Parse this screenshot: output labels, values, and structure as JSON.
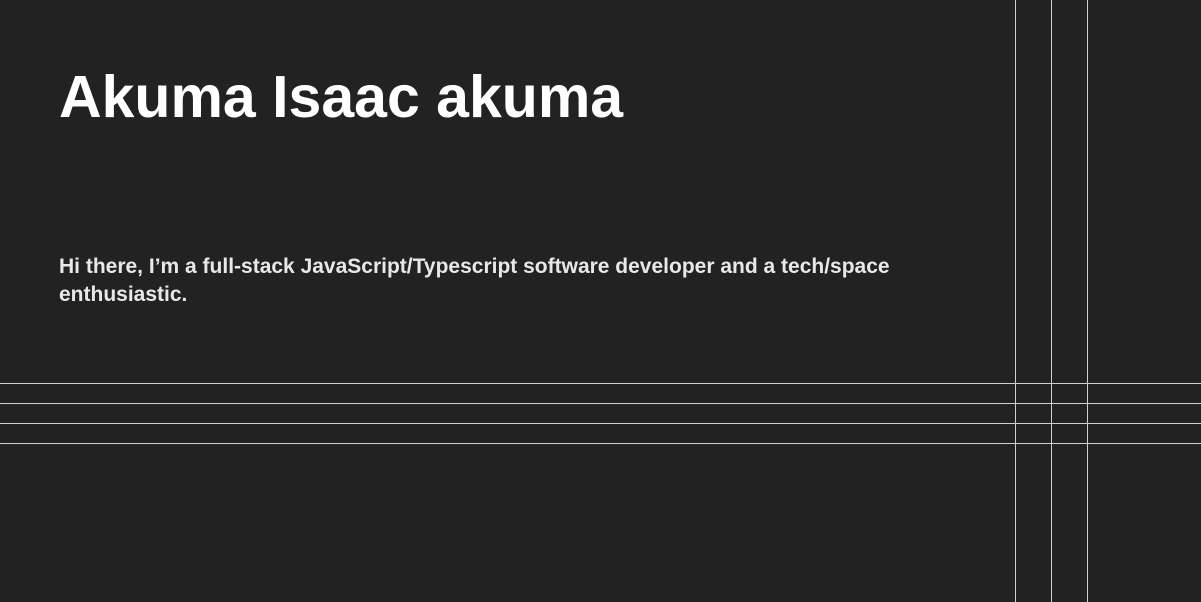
{
  "profile": {
    "name": "Akuma Isaac akuma",
    "bio": "Hi there, I’m a full-stack JavaScript/Typescript software developer and a tech/space enthusiastic."
  },
  "theme": {
    "background": "#222222",
    "text": "#ffffff",
    "line": "#cfcfcf"
  }
}
